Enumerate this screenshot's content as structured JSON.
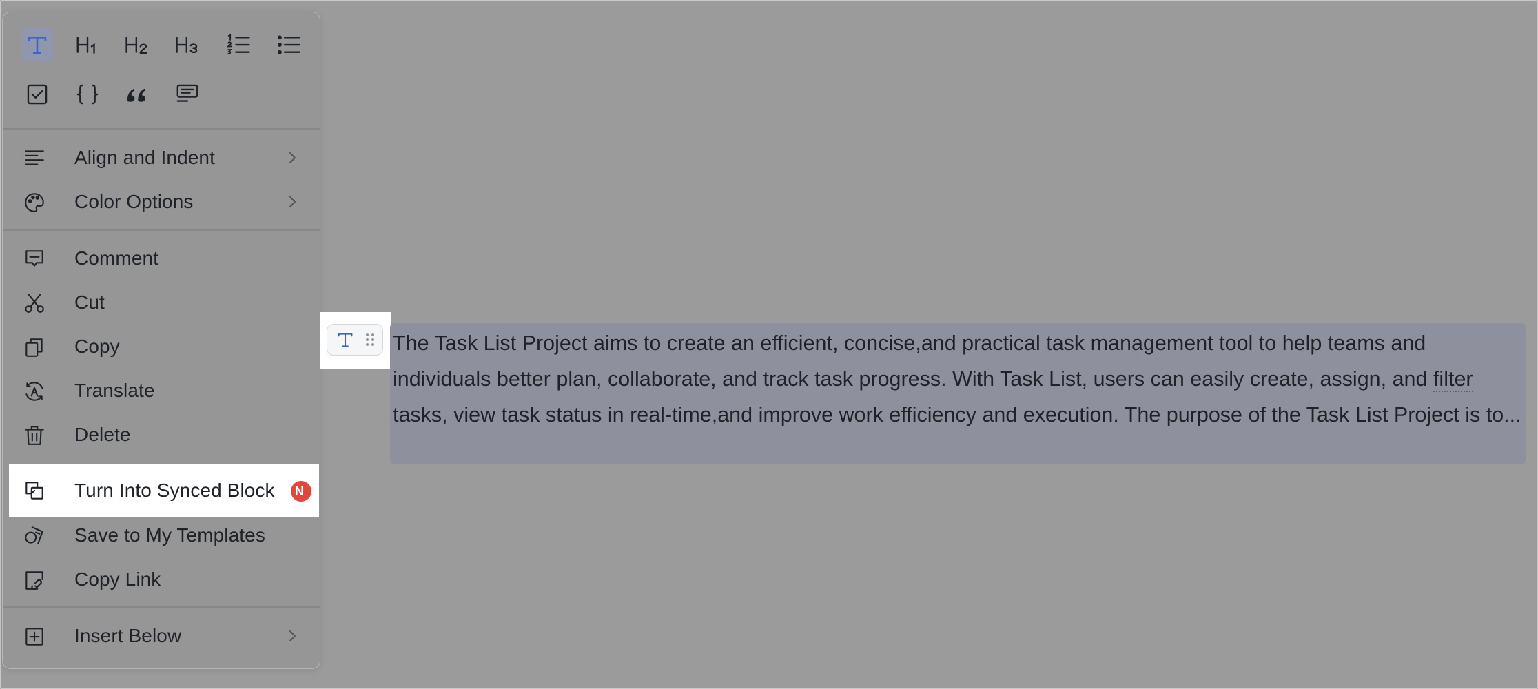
{
  "menu": {
    "block_types": [
      {
        "name": "text-icon",
        "label": "T"
      },
      {
        "name": "heading1-icon",
        "label": "H1"
      },
      {
        "name": "heading2-icon",
        "label": "H2"
      },
      {
        "name": "heading3-icon",
        "label": "H3"
      },
      {
        "name": "ordered-list-icon",
        "label": "123"
      },
      {
        "name": "bullet-list-icon",
        "label": ""
      },
      {
        "name": "checkbox-icon",
        "label": ""
      },
      {
        "name": "code-block-icon",
        "label": "{ }"
      },
      {
        "name": "quote-icon",
        "label": "“"
      },
      {
        "name": "callout-icon",
        "label": ""
      }
    ],
    "items": {
      "align_indent": "Align and Indent",
      "color_options": "Color Options",
      "comment": "Comment",
      "cut": "Cut",
      "copy": "Copy",
      "translate": "Translate",
      "delete": "Delete",
      "turn_into_synced": "Turn Into Synced Block",
      "new_badge": "N",
      "save_templates": "Save to My Templates",
      "copy_link": "Copy Link",
      "insert_below": "Insert Below"
    }
  },
  "document": {
    "paragraph_before": "The Task List Project aims to create an efficient, concise,and practical task management tool to help teams and individuals better plan, collaborate, and track task progress. With Task List, users can easily create, assign, and ",
    "underlined_word": "filter",
    "paragraph_after": " tasks, view task status in real-time,and improve work efficiency and execution. The purpose of the Task List Project is to..."
  },
  "colors": {
    "background": "#9b9b9b",
    "accent": "#3e63d1",
    "badge": "#e0473f",
    "selection": "#8e909d"
  }
}
